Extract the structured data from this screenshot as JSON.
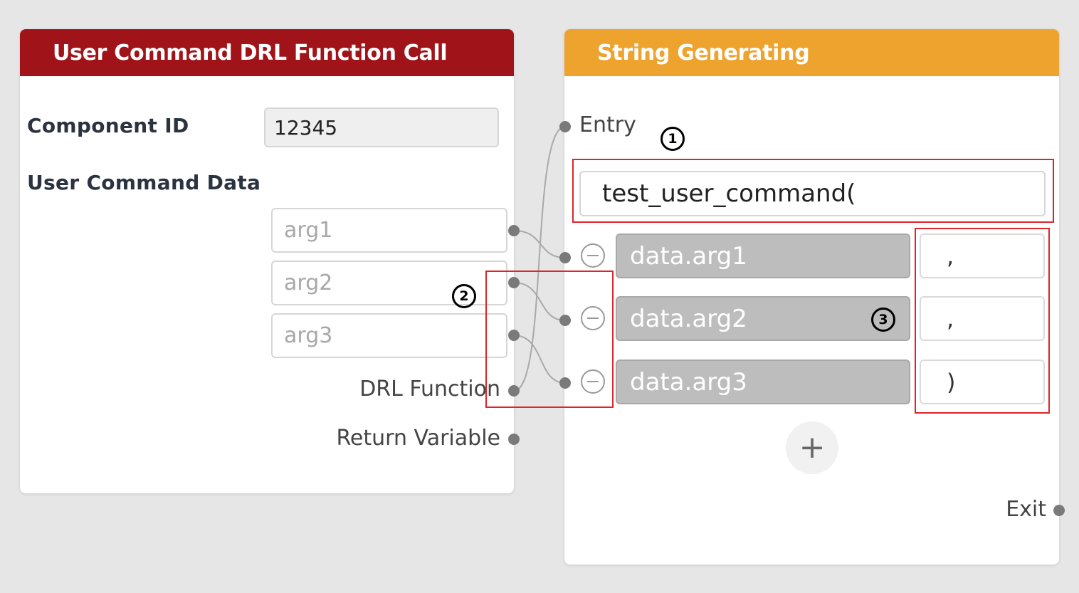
{
  "left_panel": {
    "title": "User Command DRL Function Call",
    "component_id_label": "Component ID",
    "component_id_value": "12345",
    "user_command_data_label": "User Command Data",
    "args": [
      {
        "placeholder": "arg1"
      },
      {
        "placeholder": "arg2"
      },
      {
        "placeholder": "arg3"
      }
    ],
    "drl_function_label": "DRL Function",
    "return_variable_label": "Return Variable"
  },
  "right_panel": {
    "title": "String Generating",
    "entry_label": "Entry",
    "string_input": "test_user_command(",
    "items": [
      {
        "value": "data.arg1",
        "separator": ","
      },
      {
        "value": "data.arg2",
        "separator": ","
      },
      {
        "value": "data.arg3",
        "separator": ")"
      }
    ],
    "add_button": "+",
    "exit_label": "Exit"
  },
  "annotations": {
    "callout_1": "1",
    "callout_2": "2",
    "callout_3": "3"
  },
  "colors": {
    "left_header": "#a01419",
    "right_header": "#efa32f",
    "highlight": "#e0242b"
  }
}
